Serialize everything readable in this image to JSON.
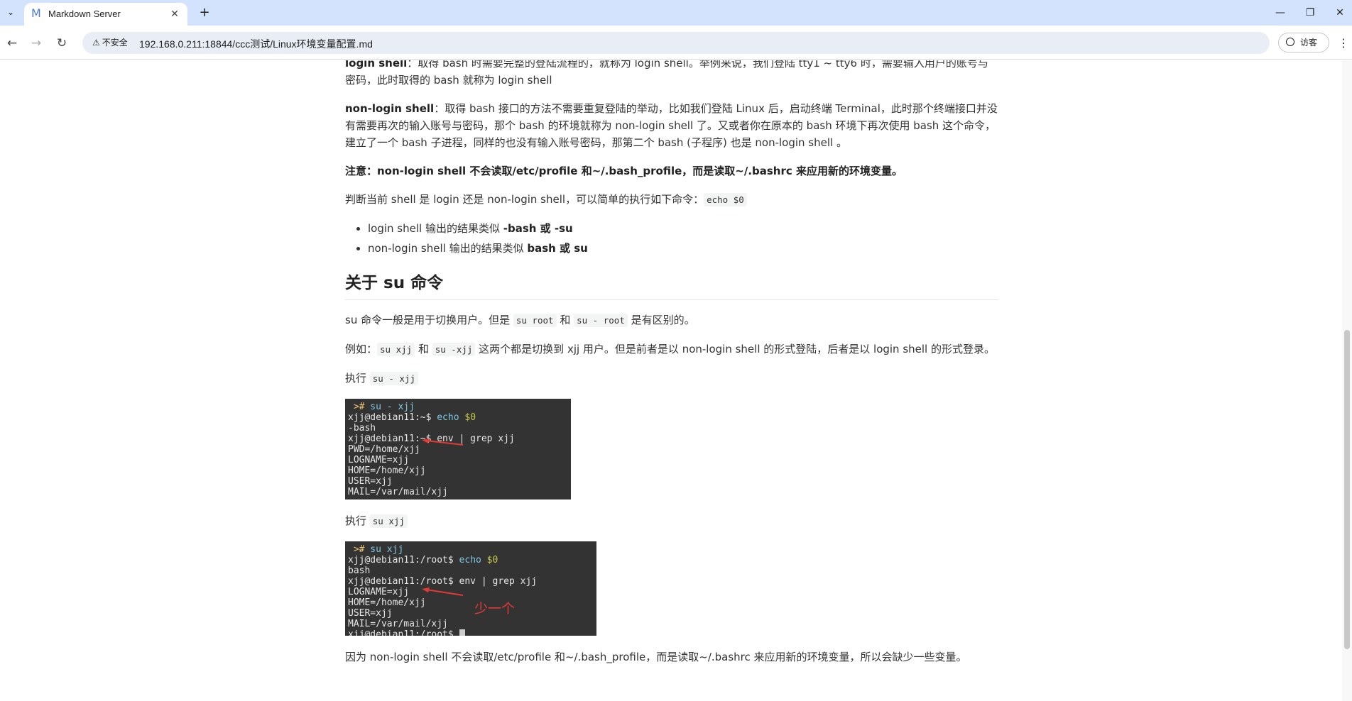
{
  "browser": {
    "tab_title": "Markdown Server",
    "tab_favicon": "M",
    "security_label": "不安全",
    "url": "192.168.0.211:18844/ccc测试/Linux环境变量配置.md",
    "guest_label": "访客"
  },
  "article": {
    "p_login_shell_term": "login shell",
    "p_login_shell_text": "：取得 bash 时需要完整的登陆流程的，就称为 login shell。举例来说，我们登陆 tty1 ~ tty6 时，需要输入用户的账号与密码，此时取得的 bash 就称为 login shell",
    "p_nonlogin_term": "non-login shell",
    "p_nonlogin_text": "：取得 bash 接口的方法不需要重复登陆的举动，比如我们登陆 Linux 后，启动终端 Terminal，此时那个终端接口并没有需要再次的输入账号与密码，那个 bash 的环境就称为 non-login shell 了。又或者你在原本的 bash 环境下再次使用 bash 这个命令，建立了一个 bash 子进程，同样的也没有输入账号密码，那第二个 bash (子程序) 也是 non-login shell 。",
    "p_note": "注意：non-login shell 不会读取/etc/profile 和~/.bash_profile，而是读取~/.bashrc 来应用新的环境变量。",
    "p_judge_text": "判断当前 shell 是 login 还是 non-login shell，可以简单的执行如下命令：",
    "p_judge_code": "echo $0",
    "bullets": [
      {
        "text": "login shell 输出的结果类似 ",
        "bold": "-bash 或 -su"
      },
      {
        "text": "non-login shell 输出的结果类似 ",
        "bold": "bash 或 su"
      }
    ],
    "h2_su": "关于 su 命令",
    "p_su_a": "su 命令一般是用于切换用户。但是 ",
    "p_su_code1": "su root",
    "p_su_b": " 和 ",
    "p_su_code2": "su - root",
    "p_su_c": " 是有区别的。",
    "p_ex_a": "例如：",
    "p_ex_code1": "su xjj",
    "p_ex_b": " 和 ",
    "p_ex_code2": "su -xjj",
    "p_ex_c": " 这两个都是切换到 xjj 用户。但是前者是以 non-login shell 的形式登陆，后者是以 login shell 的形式登录。",
    "p_exec1": "执行 ",
    "p_exec1_code": "su - xjj",
    "term1": {
      "line1_prompt": " >#",
      "line1_cmd": " su - xjj",
      "line2_prompt": "xjj@debian11:~$ ",
      "line2_cmd": "echo",
      "line2_arg": " $0",
      "line3": "-bash",
      "line4": "xjj@debian11:~$ env | grep xjj",
      "line5": "PWD=/home/xjj",
      "line6": "LOGNAME=xjj",
      "line7": "HOME=/home/xjj",
      "line8": "USER=xjj",
      "line9": "MAIL=/var/mail/xjj"
    },
    "p_exec2": "执行 ",
    "p_exec2_code": "su xjj",
    "term2": {
      "line1_prompt": " >#",
      "line1_cmd": " su xjj",
      "line2_prompt": "xjj@debian11:/root$ ",
      "line2_cmd": "echo",
      "line2_arg": " $0",
      "line3": "bash",
      "line4": "xjj@debian11:/root$ env | grep xjj",
      "line5": "LOGNAME=xjj",
      "line6": "HOME=/home/xjj",
      "line7": "USER=xjj",
      "line8": "MAIL=/var/mail/xjj",
      "line9": "xjj@debian11:/root$ ",
      "note": "少一个"
    },
    "p_because": "因为 non-login shell 不会读取/etc/profile 和~/.bash_profile，而是读取~/.bashrc 来应用新的环境变量，所以会缺少一些变量。"
  }
}
